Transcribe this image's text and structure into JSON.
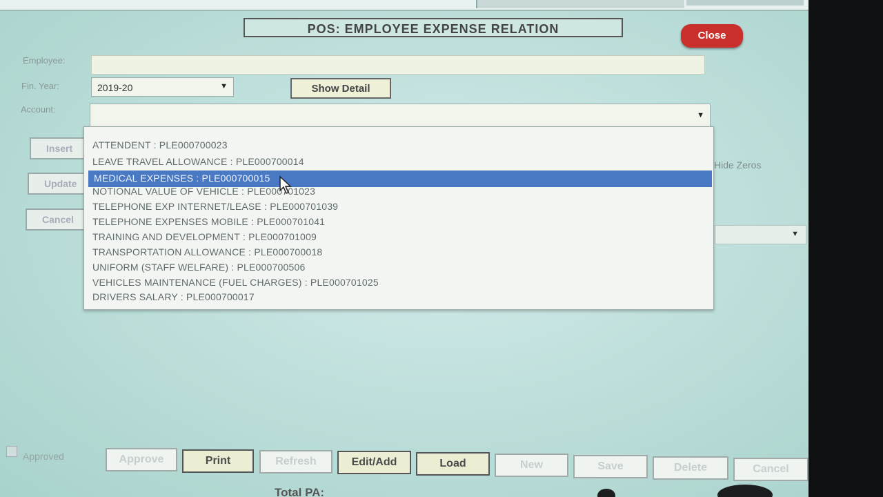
{
  "title": "POS: EMPLOYEE EXPENSE RELATION",
  "close_label": "Close",
  "employee": {
    "label": "Employee:",
    "value": ""
  },
  "fin_year": {
    "label": "Fin. Year:",
    "value": "2019-20"
  },
  "show_detail_label": "Show Detail",
  "account": {
    "label": "Account:",
    "value": ""
  },
  "side_buttons": {
    "insert": "Insert",
    "update": "Update",
    "cancel": "Cancel"
  },
  "hide_zeros_label": "Hide Zeros",
  "dropdown": {
    "selected_index": 2,
    "items": [
      "ATTENDENT : PLE000700023",
      "LEAVE TRAVEL ALLOWANCE : PLE000700014",
      "MEDICAL EXPENSES : PLE000700015",
      "NOTIONAL VALUE OF VEHICLE : PLE000701023",
      "TELEPHONE EXP INTERNET/LEASE : PLE000701039",
      "TELEPHONE EXPENSES MOBILE : PLE000701041",
      "TRAINING AND DEVELOPMENT : PLE000701009",
      "TRANSPORTATION ALLOWANCE : PLE000700018",
      "UNIFORM (STAFF WELFARE) : PLE000700506",
      "VEHICLES MAINTENANCE (FUEL CHARGES) : PLE000701025",
      "DRIVERS SALARY : PLE000700017"
    ]
  },
  "approved_label": "Approved",
  "bottom_buttons": {
    "approve": "Approve",
    "print": "Print",
    "refresh": "Refresh",
    "edit_add": "Edit/Add",
    "load": "Load",
    "new": "New",
    "save": "Save",
    "delete": "Delete",
    "cancel": "Cancel"
  },
  "total_label": "Total PA:",
  "colors": {
    "close": "#c9302c",
    "selection": "#4a79c4",
    "background": "#bfe0dc"
  }
}
